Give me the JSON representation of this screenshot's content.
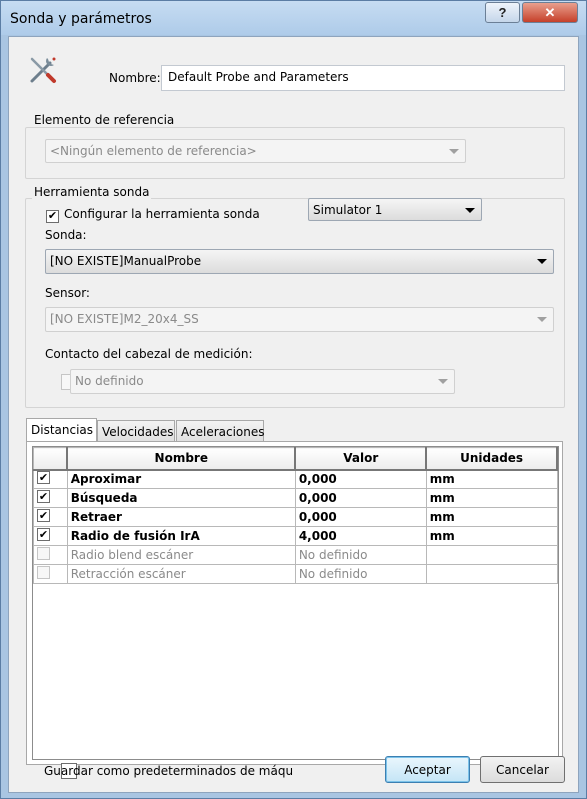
{
  "window": {
    "title": "Sonda y parámetros",
    "help_label": "?",
    "close_label": "✕"
  },
  "icons": {
    "tool": "tools-icon"
  },
  "nombre": {
    "label": "Nombre:",
    "value": "Default Probe and Parameters"
  },
  "referencia": {
    "group_title": "Elemento de referencia",
    "value": "<Ningún elemento de referencia>"
  },
  "herramienta": {
    "group_title": "Herramienta sonda",
    "configurar_label": "Configurar la herramienta sonda",
    "configurar_checked": true,
    "simulator_value": "Simulator 1",
    "sonda_label": "Sonda:",
    "sonda_value": "[NO EXISTE]ManualProbe",
    "sensor_label": "Sensor:",
    "sensor_value": "[NO EXISTE]M2_20x4_SS",
    "contacto_label": "Contacto del cabezal de medición:",
    "contacto_value": "No definido"
  },
  "tabs": [
    {
      "label": "Distancias"
    },
    {
      "label": "Velocidades"
    },
    {
      "label": "Aceleraciones"
    }
  ],
  "grid": {
    "headers": [
      "Nombre",
      "Valor",
      "Unidades"
    ],
    "rows": [
      {
        "checked": true,
        "enabled": true,
        "nombre": "Aproximar",
        "valor": "0,000",
        "unidades": "mm"
      },
      {
        "checked": true,
        "enabled": true,
        "nombre": "Búsqueda",
        "valor": "0,000",
        "unidades": "mm"
      },
      {
        "checked": true,
        "enabled": true,
        "nombre": "Retraer",
        "valor": "0,000",
        "unidades": "mm"
      },
      {
        "checked": true,
        "enabled": true,
        "nombre": "Radio de fusión IrA",
        "valor": "4,000",
        "unidades": "mm"
      },
      {
        "checked": false,
        "enabled": false,
        "nombre": "Radio blend escáner",
        "valor": "No definido",
        "unidades": ""
      },
      {
        "checked": false,
        "enabled": false,
        "nombre": "Retracción escáner",
        "valor": "No definido",
        "unidades": ""
      }
    ]
  },
  "footer": {
    "guardar_label": "Guardar como predeterminados de máqu",
    "aceptar_label": "Aceptar",
    "cancelar_label": "Cancelar"
  }
}
